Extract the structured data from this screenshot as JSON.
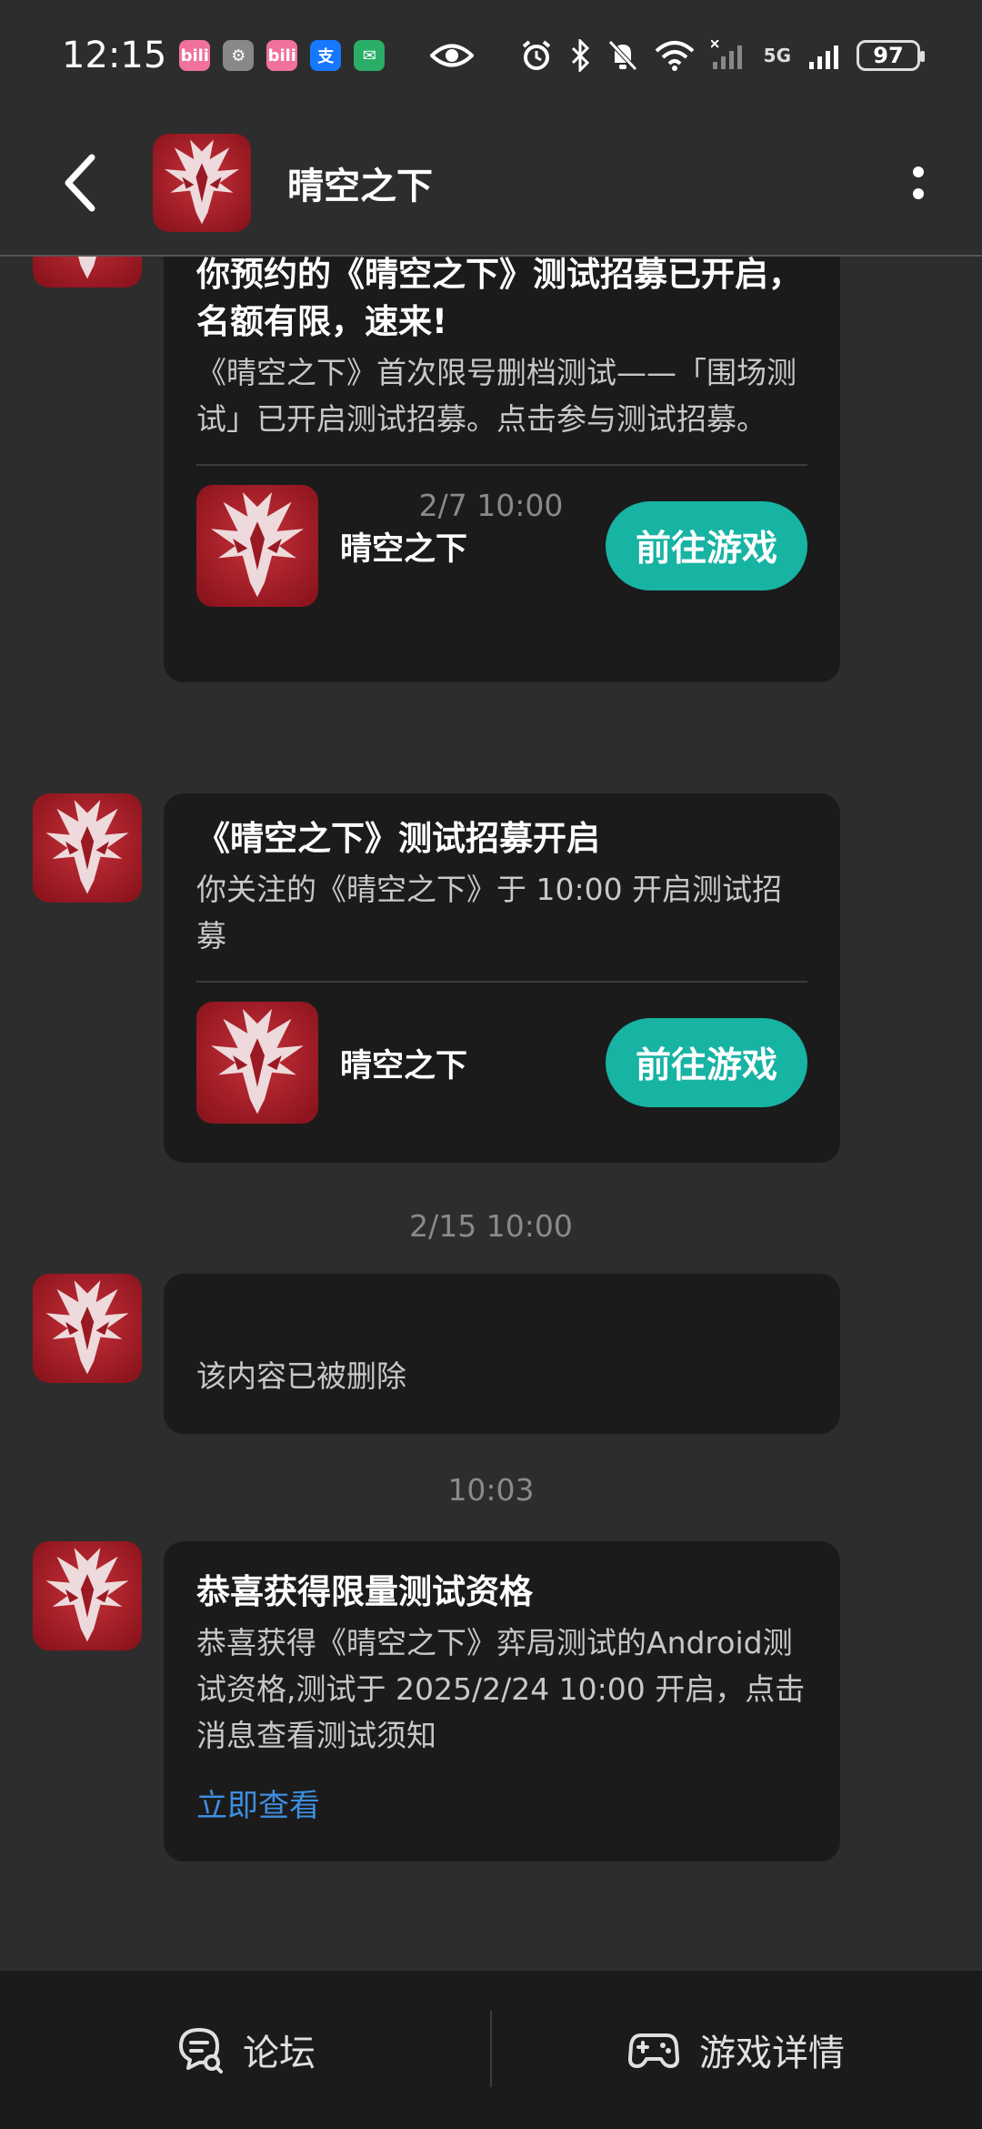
{
  "status_bar": {
    "time": "12:15",
    "apps": [
      {
        "icon": "bilibili-icon",
        "label": "bili",
        "color": "#f0729b"
      },
      {
        "icon": "settings-app-icon",
        "label": "⚙",
        "color": "#888888"
      },
      {
        "icon": "bilibili-icon",
        "label": "bili",
        "color": "#f0729b"
      },
      {
        "icon": "alipay-icon",
        "label": "支",
        "color": "#1677ff"
      },
      {
        "icon": "wechat-icon",
        "label": "✉",
        "color": "#2aae67"
      }
    ],
    "network_label": "5G",
    "battery": "97"
  },
  "header": {
    "title": "晴空之下"
  },
  "messages": [
    {
      "title": "你预约的《晴空之下》测试招募已开启，名额有限，速来!",
      "body": "《晴空之下》首次限号删档测试——「围场测试」已开启测试招募。点击参与测试招募。",
      "game_name": "晴空之下",
      "button": "前往游戏"
    },
    {
      "timestamp": "2/7  10:00",
      "title": "《晴空之下》测试招募开启",
      "body": "你关注的《晴空之下》于 10:00 开启测试招募",
      "game_name": "晴空之下",
      "button": "前往游戏"
    },
    {
      "timestamp": "2/15  10:00",
      "body": "该内容已被删除"
    },
    {
      "timestamp": "10:03",
      "title": "恭喜获得限量测试资格",
      "body": "恭喜获得《晴空之下》弈局测试的Android测试资格,测试于 2025/2/24 10:00 开启，点击消息查看测试须知",
      "link": "立即查看"
    }
  ],
  "bottom_bar": {
    "forum": "论坛",
    "details": "游戏详情"
  },
  "colors": {
    "background": "#2d2d2d",
    "bubble": "#1b1b1b",
    "accent_button": "#17b3a3",
    "link": "#3e8ee0",
    "logo_red": "#b5202c"
  }
}
